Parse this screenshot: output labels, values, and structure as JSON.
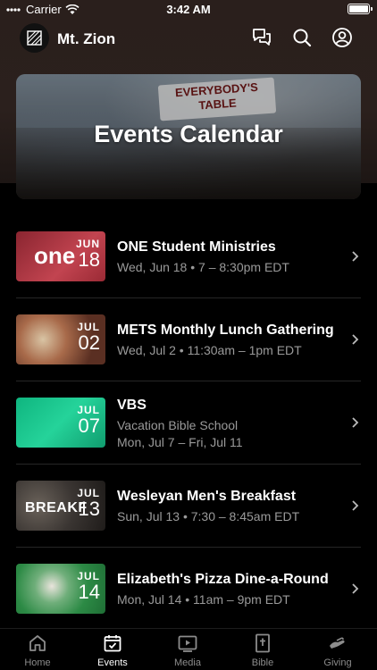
{
  "status_bar": {
    "carrier": "Carrier",
    "time": "3:42 AM"
  },
  "header": {
    "church_name": "Mt. Zion",
    "icons": [
      "chat-icon",
      "search-icon",
      "profile-icon"
    ]
  },
  "hero": {
    "title": "Events Calendar",
    "banner_text": "EVERYBODY'S TABLE"
  },
  "events": [
    {
      "name": "ONE Student Ministries",
      "lines": [
        "Wed, Jun 18 • 7 – 8:30pm EDT"
      ],
      "month": "JUN",
      "day": "18",
      "thumb_color": "#b5323a",
      "thumb_text": "one"
    },
    {
      "name": "METS Monthly Lunch Gathering",
      "lines": [
        "Wed, Jul 2 • 11:30am – 1pm EDT"
      ],
      "month": "JUL",
      "day": "02",
      "thumb_color": "#7a4a3a",
      "thumb_text": ""
    },
    {
      "name": "VBS",
      "lines": [
        "Vacation Bible School",
        "Mon, Jul 7 – Fri, Jul 11"
      ],
      "month": "JUL",
      "day": "07",
      "thumb_color": "#18c08a",
      "thumb_text": ""
    },
    {
      "name": "Wesleyan Men's Breakfast",
      "lines": [
        "Sun, Jul 13 • 7:30 – 8:45am EDT"
      ],
      "month": "JUL",
      "day": "13",
      "thumb_color": "#3a3633",
      "thumb_text": "BREAKF"
    },
    {
      "name": "Elizabeth's Pizza Dine-a-Round",
      "lines": [
        "Mon, Jul 14 • 11am – 9pm EDT"
      ],
      "month": "JUL",
      "day": "14",
      "thumb_color": "#2f8f4a",
      "thumb_text": ""
    }
  ],
  "tabs": [
    {
      "label": "Home",
      "icon": "home-icon",
      "active": false
    },
    {
      "label": "Events",
      "icon": "calendar-icon",
      "active": true
    },
    {
      "label": "Media",
      "icon": "media-icon",
      "active": false
    },
    {
      "label": "Bible",
      "icon": "bible-icon",
      "active": false
    },
    {
      "label": "Giving",
      "icon": "giving-icon",
      "active": false
    }
  ],
  "colors": {
    "background": "#000000",
    "header_bg": "#2b201d",
    "subtext": "#9a9a9a",
    "tab_inactive": "#8c8c8c"
  }
}
